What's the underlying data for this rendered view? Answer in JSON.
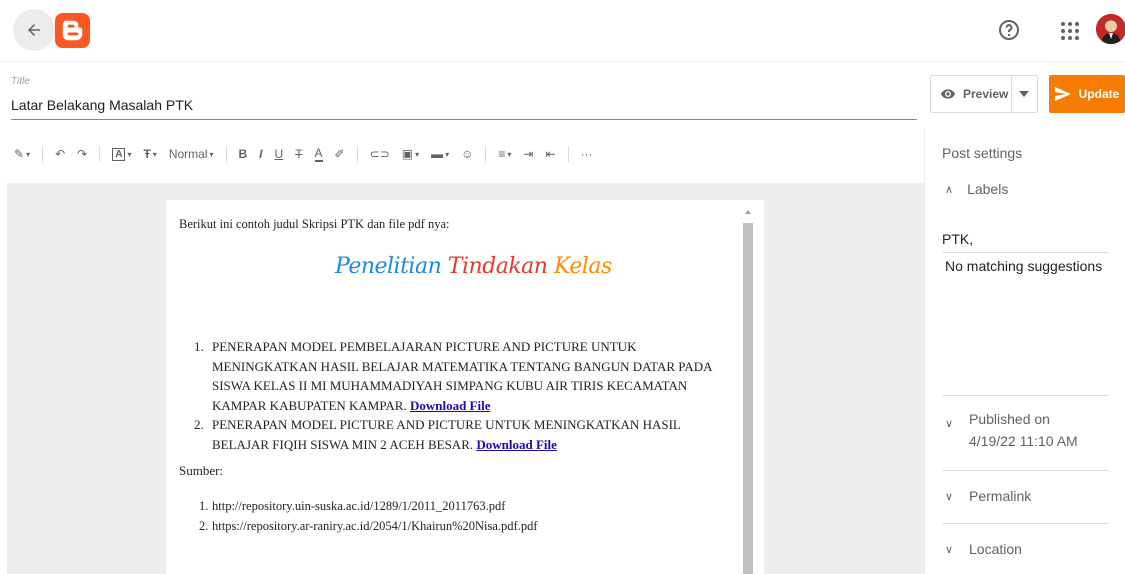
{
  "header": {
    "back_icon": "arrow-left-icon",
    "logo": "blogger-logo",
    "help_icon": "help-circle-icon",
    "apps_icon": "apps-grid-icon",
    "avatar": "user-avatar"
  },
  "post": {
    "title_label": "Title",
    "title_value": "Latar Belakang Masalah PTK"
  },
  "actions": {
    "preview_label": "Preview",
    "update_label": "Update",
    "accent_color": "#f57c00"
  },
  "toolbar": {
    "paragraph_style": "Normal"
  },
  "content": {
    "intro": "Berikut ini contoh judul Skripsi PTK dan file pdf nya:",
    "logo_words": [
      "Penelitian",
      "Tindakan",
      "Kelas"
    ],
    "items": [
      {
        "num": "1.",
        "text": "PENERAPAN MODEL PEMBELAJARAN PICTURE AND PICTURE UNTUK MENINGKATKAN HASIL BELAJAR MATEMATIKA TENTANG BANGUN DATAR PADA SISWA KELAS II MI MUHAMMADIYAH SIMPANG KUBU AIR TIRIS KECAMATAN KAMPAR KABUPATEN KAMPAR.",
        "link": "Download File"
      },
      {
        "num": "2.",
        "text": "PENERAPAN MODEL PICTURE AND PICTURE UNTUK MENINGKATKAN HASIL BELAJAR FIQIH SISWA MIN 2 ACEH BESAR.",
        "link": "Download File"
      }
    ],
    "sumber_label": "Sumber:",
    "sources": [
      {
        "num": "1.",
        "url": "http://repository.uin-suska.ac.id/1289/1/2011_2011763.pdf"
      },
      {
        "num": "2.",
        "url": "https://repository.ar-raniry.ac.id/2054/1/Khairun%20Nisa.pdf.pdf"
      }
    ]
  },
  "sidebar": {
    "title": "Post settings",
    "labels_heading": "Labels",
    "labels_value": "PTK,",
    "suggestions": "No matching suggestions",
    "published_label": "Published on",
    "published_value": "4/19/22 11:10 AM",
    "permalink_label": "Permalink",
    "location_label": "Location"
  }
}
